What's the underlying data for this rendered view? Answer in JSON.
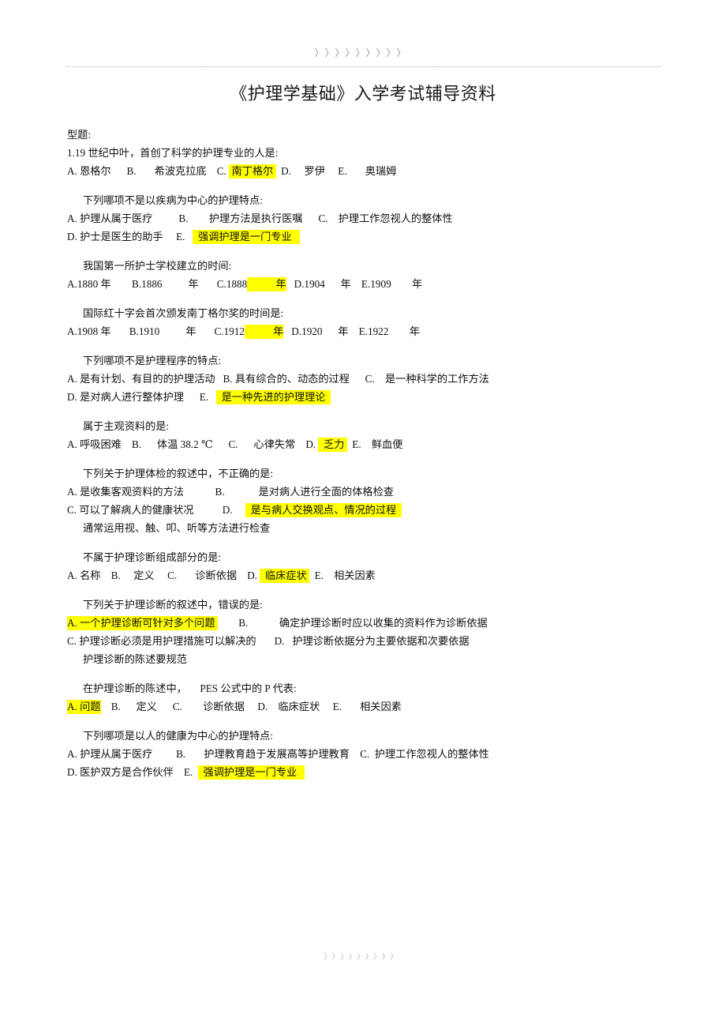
{
  "header": {
    "ornament": "〉〉〉〉〉〉〉〉〉",
    "title": "《护理学基础》入学考试辅导资料"
  },
  "footer": {
    "ornament": "〉〉〉〉〉〉〉〉〉"
  },
  "body": {
    "section_label": "型题:",
    "questions": [
      {
        "stem": "1.19 世纪中叶，首创了科学的护理专业的人是:",
        "stem_indented": false,
        "rows": [
          {
            "indented": false,
            "segments": [
              {
                "text": "A. 恩格尔      B.       希波克拉底    C. ",
                "highlight": false
              },
              {
                "text": " 南丁格尔 ",
                "highlight": true
              },
              {
                "text": "  D.     罗伊     E.       奥瑞姆",
                "highlight": false
              }
            ]
          }
        ]
      },
      {
        "stem": "下列哪项不是以疾病为中心的护理特点:",
        "stem_indented": true,
        "rows": [
          {
            "indented": false,
            "segments": [
              {
                "text": "A. 护理从属于医疗          B.        护理方法是执行医嘱      C.    护理工作忽视人的整体性",
                "highlight": false
              }
            ]
          },
          {
            "indented": false,
            "segments": [
              {
                "text": "D. 护士是医生的助手     E.   ",
                "highlight": false
              },
              {
                "text": "  强调护理是一门专业   ",
                "highlight": true
              }
            ]
          }
        ]
      },
      {
        "stem": "我国第一所护士学校建立的时间:",
        "stem_indented": true,
        "rows": [
          {
            "indented": false,
            "segments": [
              {
                "text": "A.1880 年        B.1886          年       C.1888",
                "highlight": false
              },
              {
                "text": "           年",
                "highlight": true
              },
              {
                "text": "   D.1904      年    E.1909        年",
                "highlight": false
              }
            ]
          }
        ]
      },
      {
        "stem": "国际红十字会首次颁发南丁格尔奖的时间是:",
        "stem_indented": true,
        "rows": [
          {
            "indented": false,
            "segments": [
              {
                "text": "A.1908 年       B.1910          年       C.1912",
                "highlight": false
              },
              {
                "text": "           年",
                "highlight": true
              },
              {
                "text": "   D.1920      年    E.1922        年",
                "highlight": false
              }
            ]
          }
        ]
      },
      {
        "stem": "下列哪项不是护理程序的特点:",
        "stem_indented": true,
        "rows": [
          {
            "indented": false,
            "segments": [
              {
                "text": "A. 是有计划、有目的的护理活动   B. 具有综合的、动态的过程      C.    是一种科学的工作方法",
                "highlight": false
              }
            ]
          },
          {
            "indented": false,
            "segments": [
              {
                "text": "D. 是对病人进行整体护理      E.   ",
                "highlight": false
              },
              {
                "text": "  是一种先进的护理理论  ",
                "highlight": true
              }
            ]
          }
        ]
      },
      {
        "stem": "属于主观资料的是:",
        "stem_indented": true,
        "rows": [
          {
            "indented": false,
            "segments": [
              {
                "text": "A. 呼吸困难    B.      体温 38.2 ℃      C.      心律失常    D. ",
                "highlight": false
              },
              {
                "text": "  乏力 ",
                "highlight": true
              },
              {
                "text": "  E.    鲜血便",
                "highlight": false
              }
            ]
          }
        ]
      },
      {
        "stem": "下列关于护理体检的叙述中，不正确的是:",
        "stem_indented": true,
        "rows": [
          {
            "indented": false,
            "segments": [
              {
                "text": "A. 是收集客观资料的方法            B.             是对病人进行全面的体格检查",
                "highlight": false
              }
            ]
          },
          {
            "indented": false,
            "segments": [
              {
                "text": "C. 可以了解病人的健康状况           D.     ",
                "highlight": false
              },
              {
                "text": "  是与病人交换观点、情况的过程  ",
                "highlight": true
              }
            ]
          },
          {
            "indented": true,
            "segments": [
              {
                "text": "通常运用视、触、叩、听等方法进行检查",
                "highlight": false
              }
            ]
          }
        ]
      },
      {
        "stem": "不属于护理诊断组成部分的是:",
        "stem_indented": true,
        "rows": [
          {
            "indented": false,
            "segments": [
              {
                "text": "A. 名称    B.     定义     C.       诊断依据    D. ",
                "highlight": false
              },
              {
                "text": "  临床症状 ",
                "highlight": true
              },
              {
                "text": "  E.    相关因素",
                "highlight": false
              }
            ]
          }
        ]
      },
      {
        "stem": "下列关于护理诊断的叙述中，错误的是:",
        "stem_indented": true,
        "rows": [
          {
            "indented": false,
            "segments": [
              {
                "text": "A. 一个护理诊断可针对多个问题 ",
                "highlight": true
              },
              {
                "text": "        B.            确定护理诊断时应以收集的资料作为诊断依据",
                "highlight": false
              }
            ]
          },
          {
            "indented": false,
            "segments": [
              {
                "text": "C. 护理诊断必须是用护理措施可以解决的       D.   护理诊断依据分为主要依据和次要依据",
                "highlight": false
              }
            ]
          },
          {
            "indented": true,
            "segments": [
              {
                "text": "护理诊断的陈述要规范",
                "highlight": false
              }
            ]
          }
        ]
      },
      {
        "stem": "在护理诊断的陈述中，     PES 公式中的 P 代表:",
        "stem_indented": true,
        "rows": [
          {
            "indented": false,
            "segments": [
              {
                "text": "A. 问题",
                "highlight": true
              },
              {
                "text": "    B.      定义      C.        诊断依据     D.    临床症状     E.       相关因素",
                "highlight": false
              }
            ]
          }
        ]
      },
      {
        "stem": "下列哪项是以人的健康为中心的护理特点:",
        "stem_indented": true,
        "rows": [
          {
            "indented": false,
            "segments": [
              {
                "text": "A. 护理从属于医疗         B.       护理教育趋于发展高等护理教育    C.  护理工作忽视人的整体性",
                "highlight": false
              }
            ]
          },
          {
            "indented": false,
            "segments": [
              {
                "text": "D. 医护双方是合作伙伴    E.  ",
                "highlight": false
              },
              {
                "text": "  强调护理是一门专业   ",
                "highlight": true
              }
            ]
          }
        ]
      }
    ]
  }
}
